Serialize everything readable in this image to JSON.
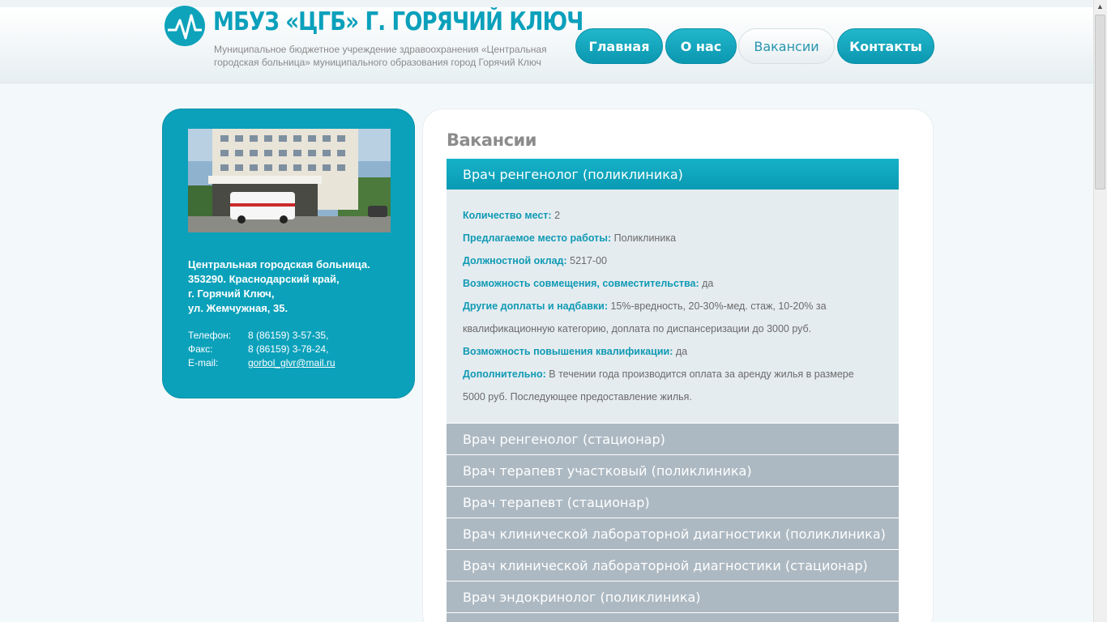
{
  "header": {
    "title": "МБУЗ «ЦГБ» Г. ГОРЯЧИЙ КЛЮЧ",
    "subtitle": "Муниципальное бюджетное учреждение здравоохранения «Центральная городская больница» муниципального образования город Горячий Ключ"
  },
  "nav": [
    {
      "label": "Главная",
      "active": false
    },
    {
      "label": "О нас",
      "active": false
    },
    {
      "label": "Вакансии",
      "active": true
    },
    {
      "label": "Контакты",
      "active": false
    }
  ],
  "sidebar": {
    "address_lines": [
      "Центральная городская больница.",
      "353290. Краснодарский край,",
      "г. Горячий Ключ,",
      "ул. Жемчужная, 35."
    ],
    "phone_label": "Телефон:",
    "phone": "8 (86159) 3-57-35,",
    "fax_label": "Факс:",
    "fax": "8 (86159) 3-78-24,",
    "email_label": "E-mail:",
    "email": "gorbol_glvr@mail.ru"
  },
  "main": {
    "title": "Вакансии",
    "open_vacancy": {
      "title": "Врач ренгенолог (поликлиника)",
      "fields": [
        {
          "key": "Количество мест:",
          "value": " 2"
        },
        {
          "key": "Предлагаемое место работы:",
          "value": " Поликлиника"
        },
        {
          "key": "Должностной оклад:",
          "value": " 5217-00"
        },
        {
          "key": "Возможность совмещения, совместительства:",
          "value": " да"
        },
        {
          "key": "Другие доплаты и надбавки:",
          "value": " 15%-вредность, 20-30%-мед. стаж, 10-20% за"
        },
        {
          "key": "",
          "value": "квалификационную категорию, доплата по диспансеризации до 3000 руб."
        },
        {
          "key": "Возможность повышения квалификации:",
          "value": " да"
        },
        {
          "key": "Дополнительно:",
          "value": " В течении года производится оплата за аренду жилья в размере"
        },
        {
          "key": "",
          "value": "5000 руб. Последующее предоставление жилья."
        }
      ]
    },
    "vacancies": [
      "Врач ренгенолог (стационар)",
      "Врач терапевт участковый (поликлиника)",
      "Врач терапевт (стационар)",
      "Врач клинической лабораторной диагностики (поликлиника)",
      "Врач клинической лабораторной диагностики (стационар)",
      "Врач эндокринолог (поликлиника)",
      ""
    ]
  }
}
